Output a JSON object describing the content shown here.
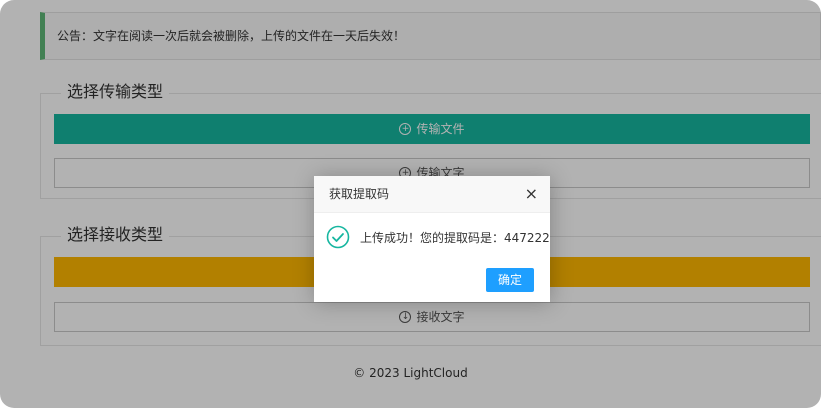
{
  "notice": {
    "text": "公告：文字在阅读一次后就会被删除，上传的文件在一天后失效！"
  },
  "send_section": {
    "title": "选择传输类型",
    "upload_file_label": "传输文件",
    "upload_text_label": "传输文字"
  },
  "receive_section": {
    "title": "选择接收类型",
    "receive_file_label": "",
    "receive_text_label": "接收文字"
  },
  "footer": {
    "text": "© 2023 LightCloud"
  },
  "dialog": {
    "title": "获取提取码",
    "close_symbol": "×",
    "message": "上传成功！您的提取码是：447222",
    "confirm_label": "确定"
  },
  "colors": {
    "teal": "#16b6a0",
    "yellow": "#ffb800",
    "blue": "#1e9fff",
    "success_green": "#16b6a0"
  },
  "icons": [
    "plus-circle-icon",
    "download-circle-icon",
    "check-circle-icon",
    "close-icon"
  ]
}
